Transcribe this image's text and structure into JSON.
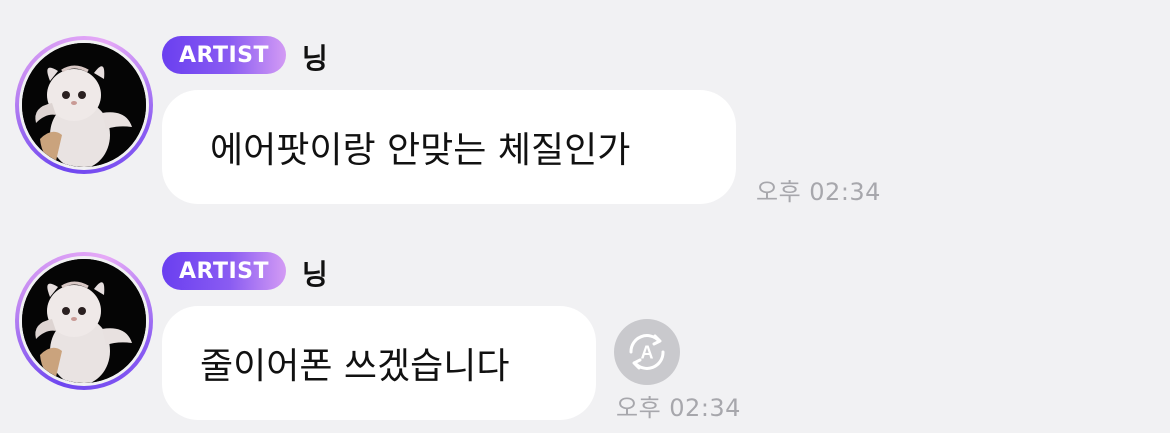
{
  "messages": [
    {
      "badge": "ARTIST",
      "sender": "닝",
      "text": "에어팟이랑 안맞는 체질인가",
      "time": "오후 02:34",
      "avatar_icon": "white-kitten-avatar",
      "has_translate_button": false
    },
    {
      "badge": "ARTIST",
      "sender": "닝",
      "text": "줄이어폰 쓰겠습니다",
      "time": "오후 02:34",
      "avatar_icon": "white-kitten-avatar",
      "has_translate_button": true,
      "translate_icon_letter": "A"
    }
  ],
  "colors": {
    "background": "#f1f1f3",
    "bubble": "#ffffff",
    "badge_gradient_start": "#6a3ff0",
    "badge_gradient_end": "#d39bf4",
    "time_text": "#a7a7ac",
    "translate_button": "#c9c9cd"
  }
}
